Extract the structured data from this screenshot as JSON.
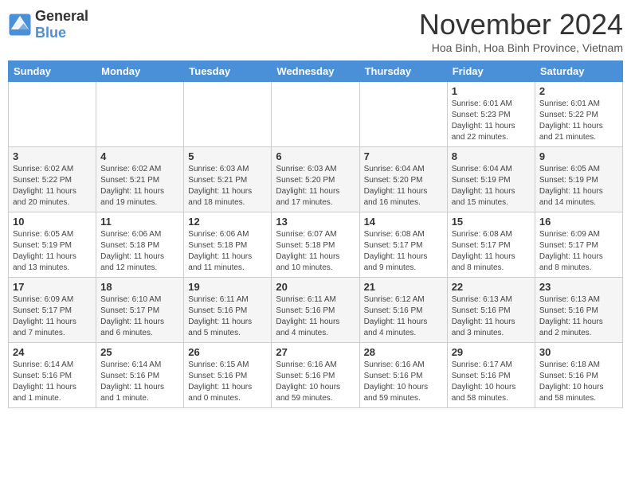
{
  "header": {
    "logo": {
      "general": "General",
      "blue": "Blue"
    },
    "title": "November 2024",
    "location": "Hoa Binh, Hoa Binh Province, Vietnam"
  },
  "columns": [
    "Sunday",
    "Monday",
    "Tuesday",
    "Wednesday",
    "Thursday",
    "Friday",
    "Saturday"
  ],
  "weeks": [
    {
      "days": [
        {
          "num": "",
          "info": "",
          "empty": true
        },
        {
          "num": "",
          "info": "",
          "empty": true
        },
        {
          "num": "",
          "info": "",
          "empty": true
        },
        {
          "num": "",
          "info": "",
          "empty": true
        },
        {
          "num": "",
          "info": "",
          "empty": true
        },
        {
          "num": "1",
          "info": "Sunrise: 6:01 AM\nSunset: 5:23 PM\nDaylight: 11 hours\nand 22 minutes."
        },
        {
          "num": "2",
          "info": "Sunrise: 6:01 AM\nSunset: 5:22 PM\nDaylight: 11 hours\nand 21 minutes."
        }
      ]
    },
    {
      "days": [
        {
          "num": "3",
          "info": "Sunrise: 6:02 AM\nSunset: 5:22 PM\nDaylight: 11 hours\nand 20 minutes."
        },
        {
          "num": "4",
          "info": "Sunrise: 6:02 AM\nSunset: 5:21 PM\nDaylight: 11 hours\nand 19 minutes."
        },
        {
          "num": "5",
          "info": "Sunrise: 6:03 AM\nSunset: 5:21 PM\nDaylight: 11 hours\nand 18 minutes."
        },
        {
          "num": "6",
          "info": "Sunrise: 6:03 AM\nSunset: 5:20 PM\nDaylight: 11 hours\nand 17 minutes."
        },
        {
          "num": "7",
          "info": "Sunrise: 6:04 AM\nSunset: 5:20 PM\nDaylight: 11 hours\nand 16 minutes."
        },
        {
          "num": "8",
          "info": "Sunrise: 6:04 AM\nSunset: 5:19 PM\nDaylight: 11 hours\nand 15 minutes."
        },
        {
          "num": "9",
          "info": "Sunrise: 6:05 AM\nSunset: 5:19 PM\nDaylight: 11 hours\nand 14 minutes."
        }
      ]
    },
    {
      "days": [
        {
          "num": "10",
          "info": "Sunrise: 6:05 AM\nSunset: 5:19 PM\nDaylight: 11 hours\nand 13 minutes."
        },
        {
          "num": "11",
          "info": "Sunrise: 6:06 AM\nSunset: 5:18 PM\nDaylight: 11 hours\nand 12 minutes."
        },
        {
          "num": "12",
          "info": "Sunrise: 6:06 AM\nSunset: 5:18 PM\nDaylight: 11 hours\nand 11 minutes."
        },
        {
          "num": "13",
          "info": "Sunrise: 6:07 AM\nSunset: 5:18 PM\nDaylight: 11 hours\nand 10 minutes."
        },
        {
          "num": "14",
          "info": "Sunrise: 6:08 AM\nSunset: 5:17 PM\nDaylight: 11 hours\nand 9 minutes."
        },
        {
          "num": "15",
          "info": "Sunrise: 6:08 AM\nSunset: 5:17 PM\nDaylight: 11 hours\nand 8 minutes."
        },
        {
          "num": "16",
          "info": "Sunrise: 6:09 AM\nSunset: 5:17 PM\nDaylight: 11 hours\nand 8 minutes."
        }
      ]
    },
    {
      "days": [
        {
          "num": "17",
          "info": "Sunrise: 6:09 AM\nSunset: 5:17 PM\nDaylight: 11 hours\nand 7 minutes."
        },
        {
          "num": "18",
          "info": "Sunrise: 6:10 AM\nSunset: 5:17 PM\nDaylight: 11 hours\nand 6 minutes."
        },
        {
          "num": "19",
          "info": "Sunrise: 6:11 AM\nSunset: 5:16 PM\nDaylight: 11 hours\nand 5 minutes."
        },
        {
          "num": "20",
          "info": "Sunrise: 6:11 AM\nSunset: 5:16 PM\nDaylight: 11 hours\nand 4 minutes."
        },
        {
          "num": "21",
          "info": "Sunrise: 6:12 AM\nSunset: 5:16 PM\nDaylight: 11 hours\nand 4 minutes."
        },
        {
          "num": "22",
          "info": "Sunrise: 6:13 AM\nSunset: 5:16 PM\nDaylight: 11 hours\nand 3 minutes."
        },
        {
          "num": "23",
          "info": "Sunrise: 6:13 AM\nSunset: 5:16 PM\nDaylight: 11 hours\nand 2 minutes."
        }
      ]
    },
    {
      "days": [
        {
          "num": "24",
          "info": "Sunrise: 6:14 AM\nSunset: 5:16 PM\nDaylight: 11 hours\nand 1 minute."
        },
        {
          "num": "25",
          "info": "Sunrise: 6:14 AM\nSunset: 5:16 PM\nDaylight: 11 hours\nand 1 minute."
        },
        {
          "num": "26",
          "info": "Sunrise: 6:15 AM\nSunset: 5:16 PM\nDaylight: 11 hours\nand 0 minutes."
        },
        {
          "num": "27",
          "info": "Sunrise: 6:16 AM\nSunset: 5:16 PM\nDaylight: 10 hours\nand 59 minutes."
        },
        {
          "num": "28",
          "info": "Sunrise: 6:16 AM\nSunset: 5:16 PM\nDaylight: 10 hours\nand 59 minutes."
        },
        {
          "num": "29",
          "info": "Sunrise: 6:17 AM\nSunset: 5:16 PM\nDaylight: 10 hours\nand 58 minutes."
        },
        {
          "num": "30",
          "info": "Sunrise: 6:18 AM\nSunset: 5:16 PM\nDaylight: 10 hours\nand 58 minutes."
        }
      ]
    }
  ]
}
